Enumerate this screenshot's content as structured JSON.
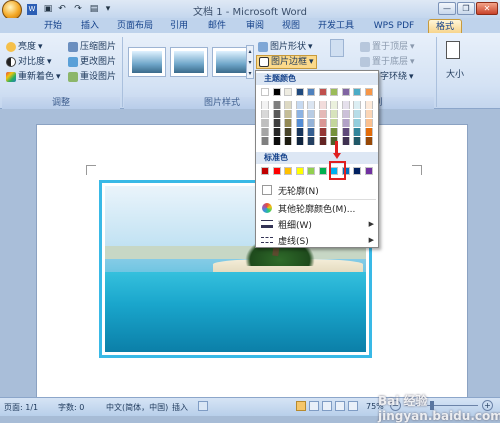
{
  "title_bar": {
    "document_title": "文档 1 - Microsoft Word"
  },
  "tabs": [
    "开始",
    "插入",
    "页面布局",
    "引用",
    "邮件",
    "审阅",
    "视图",
    "开发工具",
    "WPS PDF",
    "格式"
  ],
  "ribbon": {
    "adjust": {
      "brightness": "亮度",
      "contrast": "对比度",
      "recolor": "重新着色",
      "compress": "压缩图片",
      "change": "更改图片",
      "reset": "重设图片",
      "group_label": "调整"
    },
    "picture_styles": {
      "shape": "图片形状",
      "border": "图片边框",
      "group_label": "图片样式"
    },
    "arrange": {
      "bring_front": "置于顶层",
      "send_back": "置于底层",
      "text_wrap": "字环绕",
      "group_label": "列"
    },
    "size": {
      "label": "大小"
    }
  },
  "dropdown": {
    "theme_colors_label": "主题颜色",
    "standard_colors_label": "标准色",
    "no_outline": "无轮廓(N)",
    "more_colors": "其他轮廓颜色(M)...",
    "weight": "粗细(W)",
    "dashes": "虚线(S)",
    "theme_top": [
      "#ffffff",
      "#000000",
      "#eeece1",
      "#1f497d",
      "#4f81bd",
      "#c0504d",
      "#9bbb59",
      "#8064a2",
      "#4bacc6",
      "#f79646"
    ],
    "theme_shades": [
      [
        "#f2f2f2",
        "#7f7f7f",
        "#ddd9c3",
        "#c6d9f0",
        "#dbe5f1",
        "#f2dcdb",
        "#ebf1dd",
        "#e5e0ec",
        "#dbeef3",
        "#fdeada"
      ],
      [
        "#d8d8d8",
        "#595959",
        "#c4bd97",
        "#8db3e2",
        "#b8cce4",
        "#e5b9b7",
        "#d7e3bc",
        "#ccc1d9",
        "#b7dde8",
        "#fbd5b5"
      ],
      [
        "#bfbfbf",
        "#3f3f3f",
        "#938953",
        "#548dd4",
        "#95b3d7",
        "#d99694",
        "#c3d69b",
        "#b2a2c7",
        "#92cddc",
        "#fac08f"
      ],
      [
        "#a5a5a5",
        "#262626",
        "#494429",
        "#17365d",
        "#366092",
        "#953734",
        "#76923c",
        "#5f497a",
        "#31859b",
        "#e36c09"
      ],
      [
        "#7f7f7f",
        "#0c0c0c",
        "#1d1b10",
        "#0f243e",
        "#244061",
        "#632423",
        "#4f6128",
        "#3f3151",
        "#205867",
        "#974806"
      ]
    ],
    "standard": [
      "#c00000",
      "#ff0000",
      "#ffc000",
      "#ffff00",
      "#92d050",
      "#00b050",
      "#00b0f0",
      "#0070c0",
      "#002060",
      "#7030a0"
    ]
  },
  "status_bar": {
    "page": "页面: 1/1",
    "words": "字数: 0",
    "language": "中文(简体，中国)",
    "mode": "插入",
    "zoom": "75%"
  },
  "watermark": "Bai 经验 jingyan.baidu.com"
}
